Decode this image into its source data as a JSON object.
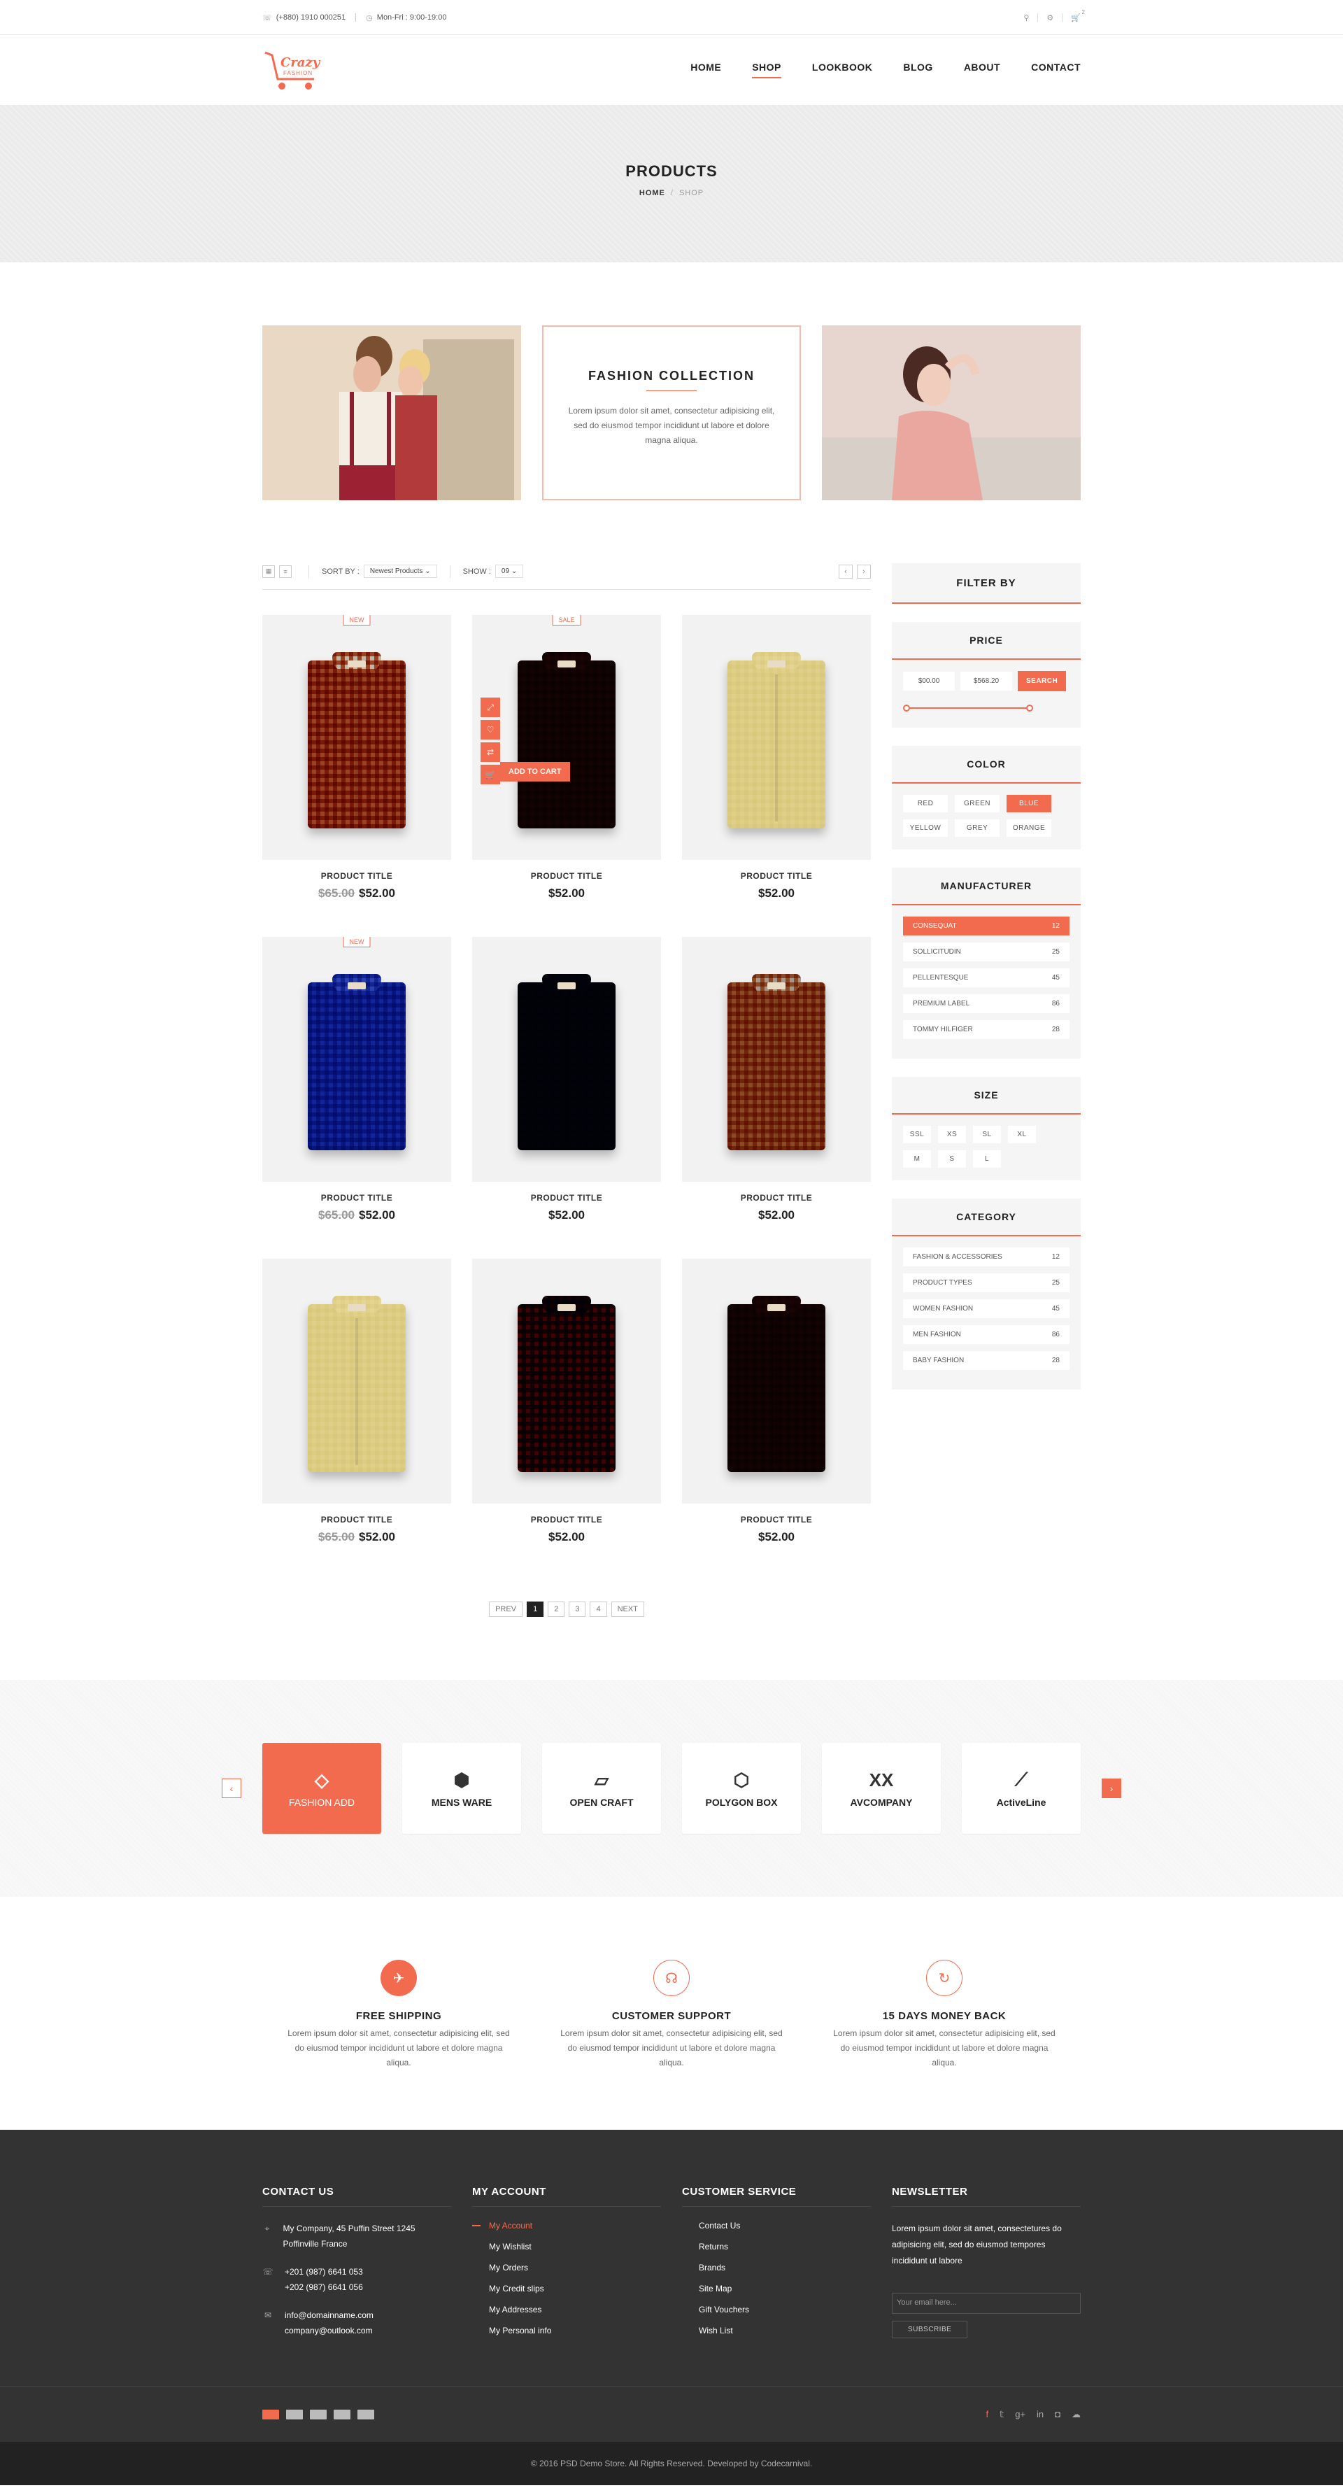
{
  "topbar": {
    "phone": "(+880) 1910 000251",
    "hours": "Mon-Fri : 9:00-19:00",
    "cart_count": "2"
  },
  "logo": {
    "line1": "Crazy",
    "line2": "FASHION"
  },
  "nav": [
    {
      "label": "HOME"
    },
    {
      "label": "SHOP"
    },
    {
      "label": "LOOKBOOK"
    },
    {
      "label": "BLOG"
    },
    {
      "label": "ABOUT"
    },
    {
      "label": "CONTACT"
    }
  ],
  "banner": {
    "title": "PRODUCTS",
    "crumb_home": "HOME",
    "crumb_sep": "/",
    "crumb_current": "SHOP"
  },
  "promo": {
    "title": "FASHION COLLECTION",
    "text": "Lorem ipsum dolor sit amet, consectetur adipisicing elit, sed do eiusmod tempor incididunt ut labore et dolore magna aliqua."
  },
  "toolbar": {
    "sort_label": "SORT BY :",
    "sort_value": "Newest Products",
    "show_label": "SHOW :",
    "show_value": "09"
  },
  "products": [
    {
      "title": "PRODUCT TITLE",
      "old": "$65.00",
      "price": "$52.00",
      "badge": "NEW",
      "c1": "#b8552e",
      "c2": "#e8e4dd"
    },
    {
      "title": "PRODUCT TITLE",
      "old": "",
      "price": "$52.00",
      "badge": "SALE",
      "c1": "#5a2a33",
      "c2": "#7b3a40"
    },
    {
      "title": "PRODUCT TITLE",
      "old": "",
      "price": "$52.00",
      "badge": "",
      "c1": "#f1ebc8",
      "c2": "#f6f0d4"
    },
    {
      "title": "PRODUCT TITLE",
      "old": "$65.00",
      "price": "$52.00",
      "badge": "NEW",
      "c1": "#3e5cc0",
      "c2": "#8ea2e0"
    },
    {
      "title": "PRODUCT TITLE",
      "old": "",
      "price": "$52.00",
      "badge": "",
      "c1": "#25284a",
      "c2": "#33365e"
    },
    {
      "title": "PRODUCT TITLE",
      "old": "",
      "price": "$52.00",
      "badge": "",
      "c1": "#b86a3a",
      "c2": "#dcd6d0"
    },
    {
      "title": "PRODUCT TITLE",
      "old": "$65.00",
      "price": "$52.00",
      "badge": "",
      "c1": "#f1ebc8",
      "c2": "#f6f0d4"
    },
    {
      "title": "PRODUCT TITLE",
      "old": "",
      "price": "$52.00",
      "badge": "",
      "c1": "#a3222e",
      "c2": "#2c3050"
    },
    {
      "title": "PRODUCT TITLE",
      "old": "",
      "price": "$52.00",
      "badge": "",
      "c1": "#5a2a33",
      "c2": "#7b3a40"
    }
  ],
  "add_to_cart": "ADD TO CART",
  "pager": {
    "prev": "PREV",
    "pages": [
      "1",
      "2",
      "3",
      "4"
    ],
    "next": "NEXT"
  },
  "sidebar": {
    "title": "FILTER BY",
    "price": {
      "title": "PRICE",
      "min": "$00.00",
      "max": "$568.20",
      "button": "SEARCH"
    },
    "color": {
      "title": "COLOR",
      "items": [
        "RED",
        "GREEN",
        "BLUE",
        "YELLOW",
        "GREY",
        "ORANGE"
      ],
      "active": "BLUE"
    },
    "manufacturer": {
      "title": "MANUFACTURER",
      "items": [
        {
          "name": "CONSEQUAT",
          "count": "12"
        },
        {
          "name": "SOLLICITUDIN",
          "count": "25"
        },
        {
          "name": "PELLENTESQUE",
          "count": "45"
        },
        {
          "name": "PREMIUM LABEL",
          "count": "86"
        },
        {
          "name": "TOMMY HILFIGER",
          "count": "28"
        }
      ]
    },
    "size": {
      "title": "SIZE",
      "items": [
        "SSL",
        "XS",
        "SL",
        "XL",
        "M",
        "S",
        "L"
      ]
    },
    "category": {
      "title": "CATEGORY",
      "items": [
        {
          "name": "FASHION & ACCESSORIES",
          "count": "12"
        },
        {
          "name": "PRODUCT TYPES",
          "count": "25"
        },
        {
          "name": "WOMEN FASHION",
          "count": "45"
        },
        {
          "name": "MEN FASHION",
          "count": "86"
        },
        {
          "name": "BABY FASHION",
          "count": "28"
        }
      ]
    }
  },
  "brands": [
    "FASHION ADD",
    "MENS WARE",
    "OPEN CRAFT",
    "POLYGON BOX",
    "AVCOMPANY",
    "ActiveLine"
  ],
  "features": [
    {
      "title": "FREE SHIPPING",
      "text": "Lorem ipsum dolor sit amet, consectetur adipisicing elit, sed do eiusmod tempor incididunt ut labore et dolore magna aliqua."
    },
    {
      "title": "CUSTOMER SUPPORT",
      "text": "Lorem ipsum dolor sit amet, consectetur adipisicing elit, sed do eiusmod tempor incididunt ut labore et dolore magna aliqua."
    },
    {
      "title": "15 DAYS MONEY BACK",
      "text": "Lorem ipsum dolor sit amet, consectetur adipisicing elit, sed do eiusmod tempor incididunt ut labore et dolore magna aliqua."
    }
  ],
  "footer": {
    "contact_title": "CONTACT US",
    "address": "My Company, 45 Puffin Street 1245 Poffinville France",
    "phone1": "+201 (987) 6641 053",
    "phone2": "+202 (987) 6641 056",
    "email1": "info@domainname.com",
    "email2": "company@outlook.com",
    "account_title": "MY ACCOUNT",
    "account_links": [
      "My Account",
      "My Wishlist",
      "My Orders",
      "My Credit slips",
      "My Addresses",
      "My Personal info"
    ],
    "service_title": "CUSTOMER SERVICE",
    "service_links": [
      "Contact Us",
      "Returns",
      "Brands",
      "Site Map",
      "Gift Vouchers",
      "Wish List"
    ],
    "newsletter_title": "NEWSLETTER",
    "newsletter_text": "Lorem ipsum dolor sit amet, consectetures do adipisicing elit, sed do eiusmod tempores incididunt ut labore",
    "newsletter_placeholder": "Your email here...",
    "subscribe": "SUBSCRIBE",
    "copyright": "© 2016 PSD Demo Store. All Rights Reserved. Developed by Codecarnival."
  }
}
